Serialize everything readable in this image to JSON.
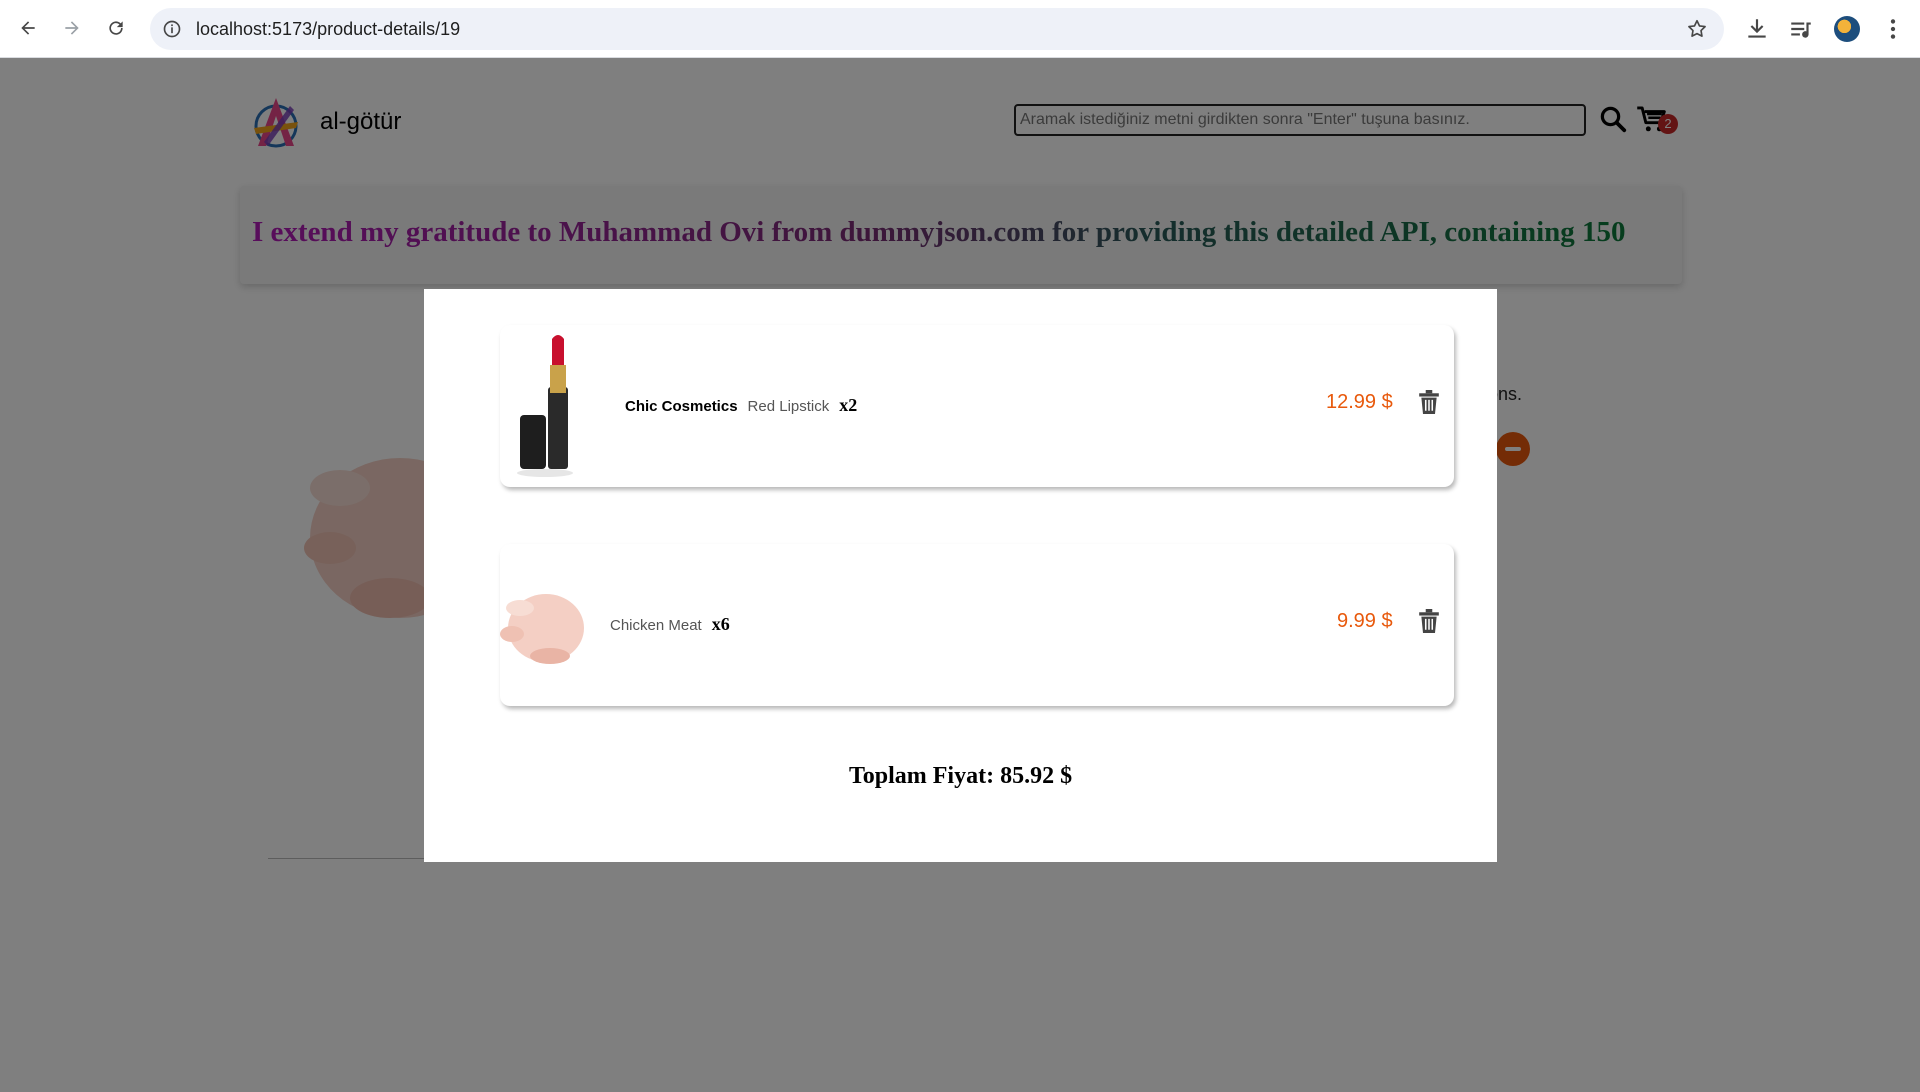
{
  "browser": {
    "url": "localhost:5173/product-details/19"
  },
  "header": {
    "brand": "al-götür",
    "search_placeholder": "Aramak istediğiniz metni girdikten sonra \"Enter\" tuşuna basınız.",
    "cart_count": "2"
  },
  "banner": {
    "text": "I extend my gratitude to Muhammad Ovi from dummyjson.com for providing this detailed API, containing 150"
  },
  "background": {
    "side_text": "ons."
  },
  "cart": {
    "items": [
      {
        "brand": "Chic Cosmetics",
        "title": "Red Lipstick",
        "qty": "x2",
        "price": "12.99 $"
      },
      {
        "brand": "",
        "title": "Chicken Meat",
        "qty": "x6",
        "price": "9.99 $"
      }
    ],
    "total": "Toplam Fiyat: 85.92 $"
  },
  "colors": {
    "accent": "#e8590c",
    "badge": "#c62828"
  }
}
